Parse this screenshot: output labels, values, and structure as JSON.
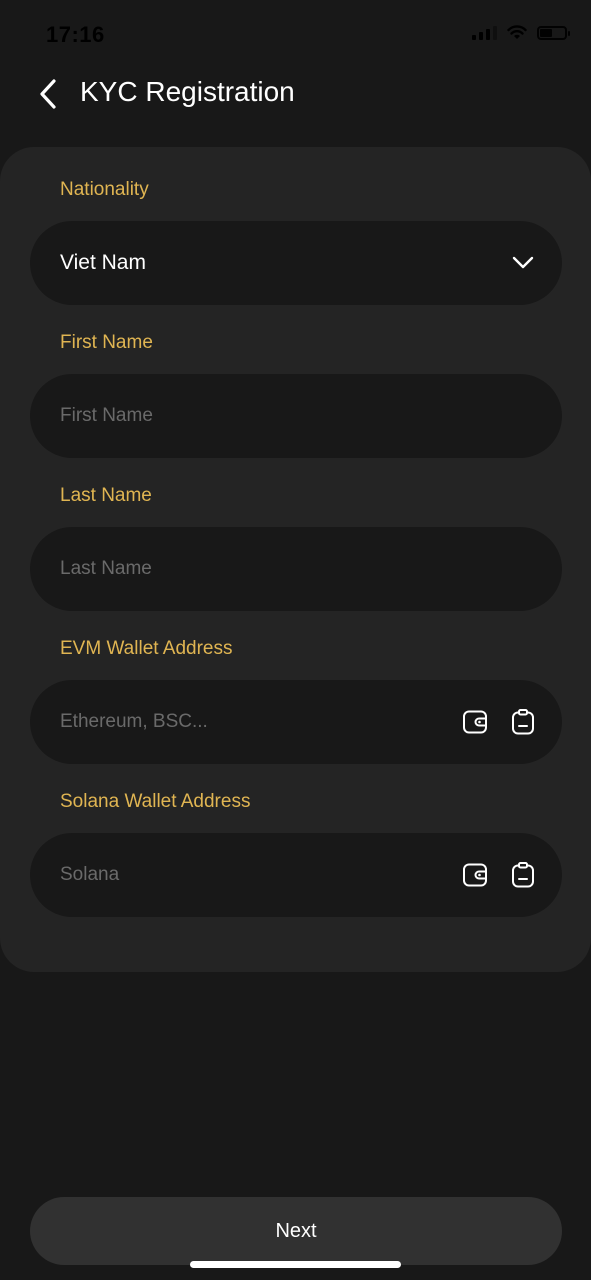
{
  "status_bar": {
    "time": "17:16"
  },
  "header": {
    "title": "KYC Registration"
  },
  "form": {
    "nationality": {
      "label": "Nationality",
      "value": "Viet Nam"
    },
    "first_name": {
      "label": "First Name",
      "placeholder": "First Name"
    },
    "last_name": {
      "label": "Last Name",
      "placeholder": "Last Name"
    },
    "evm_wallet": {
      "label": "EVM Wallet Address",
      "placeholder": "Ethereum, BSC..."
    },
    "solana_wallet": {
      "label": "Solana Wallet Address",
      "placeholder": "Solana"
    }
  },
  "footer": {
    "next_label": "Next"
  },
  "colors": {
    "background": "#181818",
    "card": "#242424",
    "label_accent": "#e0b552",
    "button": "#313131",
    "placeholder": "#6a6a6a"
  },
  "icons": [
    "chevron-left-icon",
    "chevron-down-icon",
    "wallet-icon",
    "clipboard-icon",
    "signal-icon",
    "wifi-icon",
    "battery-icon"
  ]
}
